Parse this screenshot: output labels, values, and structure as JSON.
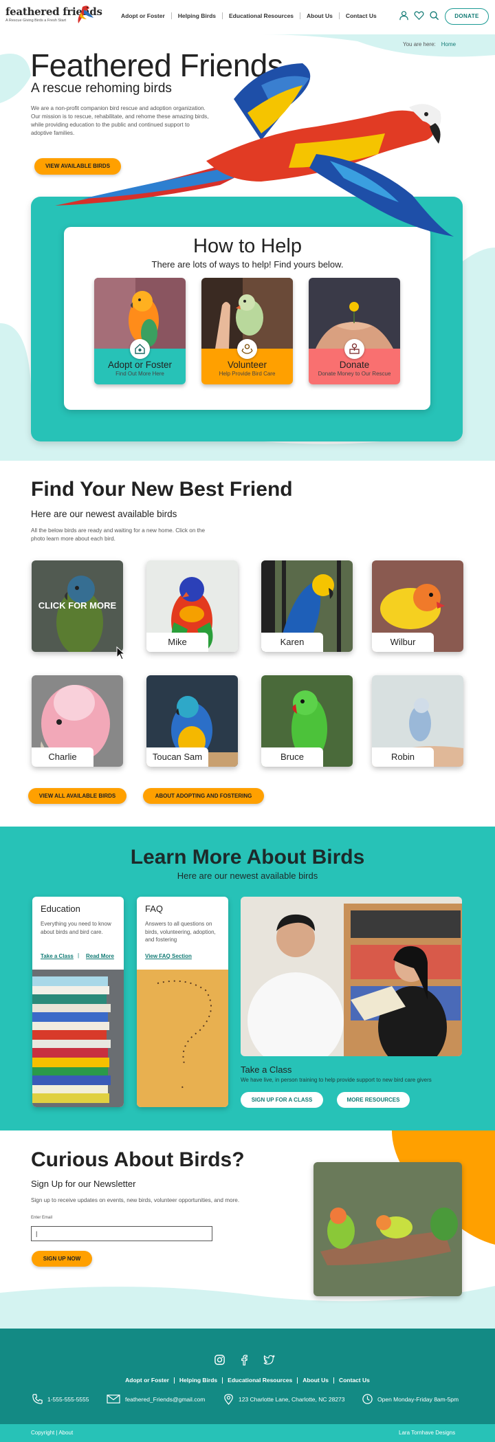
{
  "brand": {
    "name": "feathered friends",
    "tagline": "A Rescue Giving Birds a Fresh Start"
  },
  "nav": [
    "Adopt or Foster",
    "Helping Birds",
    "Educational Resources",
    "About Us",
    "Contact Us"
  ],
  "header": {
    "donate_label": "DONATE",
    "icons": [
      "user-icon",
      "heart-icon",
      "search-icon"
    ]
  },
  "breadcrumb": {
    "prefix": "You are here:",
    "current": "Home"
  },
  "hero": {
    "title": "Feathered Friends",
    "subtitle": "A rescue rehoming birds",
    "description": "We are a non-profit companion bird rescue and adoption organization. Our mission is to rescue, rehabilitate, and rehome these amazing birds, while providing education to the public and continued support to adoptive families.",
    "button": "VIEW AVAILABLE BIRDS"
  },
  "help": {
    "title": "How to Help",
    "subtitle": "There are lots of ways to help! Find yours below.",
    "cards": [
      {
        "title": "Adopt or Foster",
        "sub": "Find Out More Here",
        "color": "#27c2b7",
        "icon": "house-bird-icon"
      },
      {
        "title": "Volunteer",
        "sub": "Help Provide Bird Care",
        "color": "#ffa000",
        "icon": "helping-hands-icon"
      },
      {
        "title": "Donate",
        "sub": "Donate Money to Our Rescue",
        "color": "#f97070",
        "icon": "donate-box-icon"
      }
    ]
  },
  "find": {
    "title": "Find Your New Best Friend",
    "subtitle": "Here are our newest available birds",
    "description": "All the below birds are ready and waiting for a new home. Click on the photo learn more about each bird.",
    "overlay": "CLICK FOR MORE",
    "birds": [
      "",
      "Mike",
      "Karen",
      "Wilbur",
      "Charlie",
      "Toucan Sam",
      "Bruce",
      "Robin"
    ],
    "buttons": [
      "VIEW ALL AVAILABLE BIRDS",
      "ABOUT ADOPTING AND FOSTERING"
    ]
  },
  "learn": {
    "title": "Learn More About Birds",
    "subtitle": "Here are our newest available birds",
    "education": {
      "title": "Education",
      "desc": "Everything you need to know about birds and bird care.",
      "link1": "Take a Class",
      "link2": "Read More"
    },
    "faq": {
      "title": "FAQ",
      "desc": "Answers to all questions on birds, volunteering, adoption, and fostering",
      "link": "View FAQ Section"
    },
    "class": {
      "title": "Take a Class",
      "desc": "We have live, in person training to help provide support to new bird care givers",
      "btn1": "SIGN UP FOR A CLASS",
      "btn2": "MORE RESOURCES"
    }
  },
  "newsletter": {
    "title": "Curious About Birds?",
    "subtitle": "Sign Up for our Newsletter",
    "description": "Sign up to receive updates on events, new birds, volunteer opportunities, and more.",
    "label": "Enter Email",
    "value": "|",
    "button": "SIGN UP NOW"
  },
  "footer": {
    "social": [
      "instagram-icon",
      "facebook-icon",
      "twitter-icon"
    ],
    "nav": [
      "Adopt or Foster",
      "Helping Birds",
      "Educational Resources",
      "About Us",
      "Contact Us"
    ],
    "phone": "1-555-555-5555",
    "email": "feathered_Friends@gmail.com",
    "address": "123 Charlotte Lane, Charlotte, NC 28273",
    "hours": "Open Monday-Friday 8am-5pm",
    "copyright": "Copyright | About",
    "credit": "Lara Tornhave Designs"
  },
  "colors": {
    "teal": "#27c2b7",
    "dark_teal": "#138a84",
    "orange": "#ffa000",
    "coral": "#f97070",
    "light_teal": "#d4f3f1"
  }
}
